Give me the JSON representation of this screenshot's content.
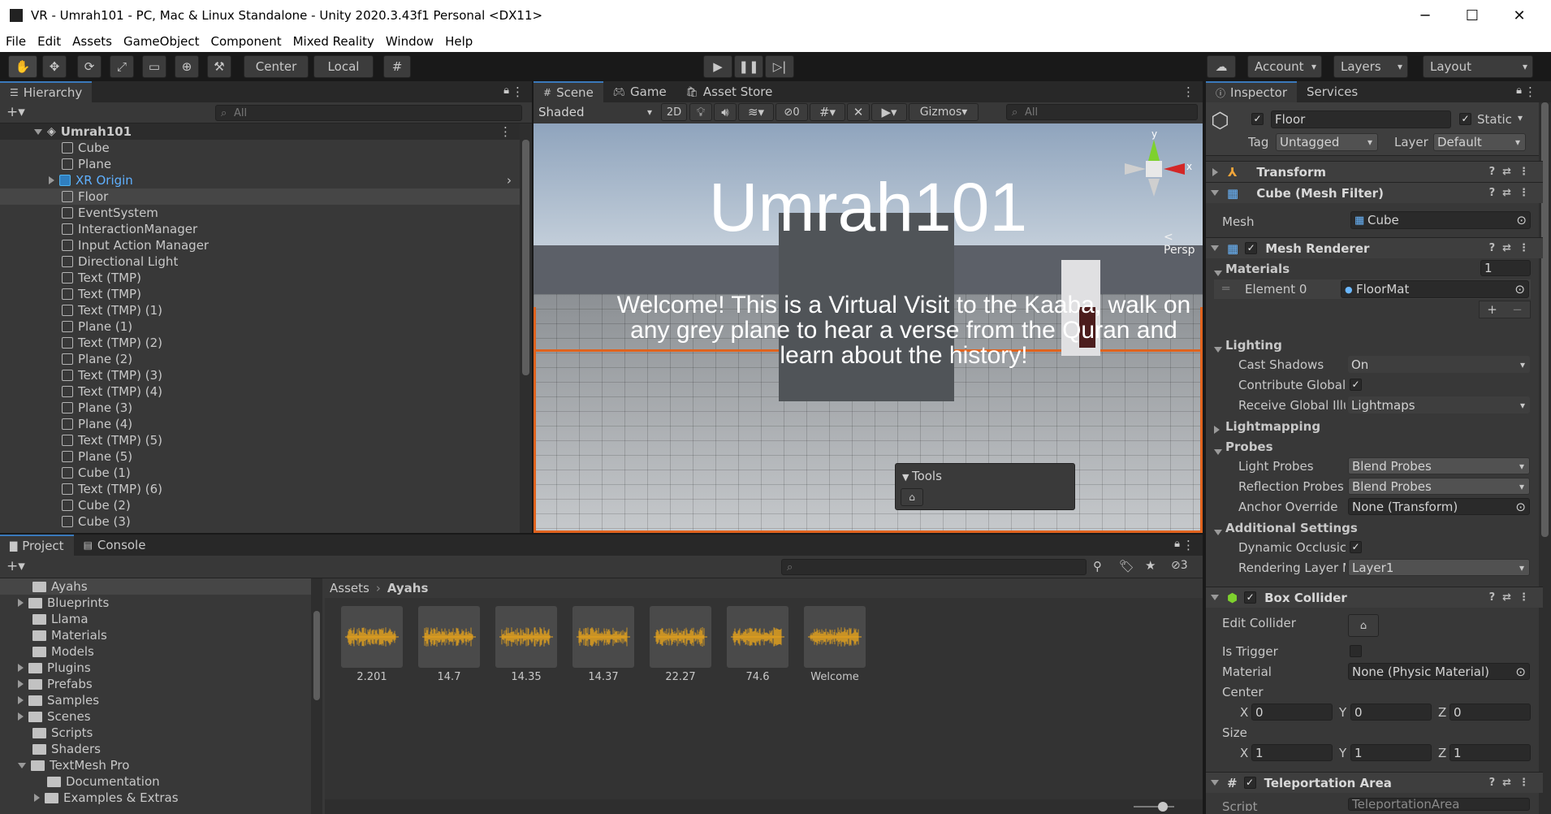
{
  "window": {
    "title": "VR - Umrah101 - PC, Mac & Linux Standalone - Unity 2020.3.43f1 Personal <DX11>"
  },
  "menu": [
    "File",
    "Edit",
    "Assets",
    "GameObject",
    "Component",
    "Mixed Reality",
    "Window",
    "Help"
  ],
  "toolbar": {
    "center": "Center",
    "local": "Local",
    "account": "Account",
    "layers": "Layers",
    "layout": "Layout"
  },
  "hierarchy": {
    "tab": "Hierarchy",
    "search_placeholder": "All",
    "scene": "Umrah101",
    "items": [
      "Cube",
      "Plane",
      "XR Origin",
      "Floor",
      "EventSystem",
      "InteractionManager",
      "Input Action Manager",
      "Directional Light",
      "Text (TMP)",
      "Text (TMP)",
      "Text (TMP) (1)",
      "Plane (1)",
      "Text (TMP) (2)",
      "Plane (2)",
      "Text (TMP) (3)",
      "Text (TMP) (4)",
      "Plane (3)",
      "Plane (4)",
      "Text (TMP) (5)",
      "Plane (5)",
      "Cube (1)",
      "Text (TMP) (6)",
      "Cube (2)",
      "Cube (3)"
    ]
  },
  "scene_view": {
    "tabs": [
      "Scene",
      "Game",
      "Asset Store"
    ],
    "shading": "Shaded",
    "mode_2d": "2D",
    "hidden_count": "0",
    "gizmos": "Gizmos",
    "search_placeholder": "All",
    "persp": "< Persp",
    "axis_x": "x",
    "axis_y": "y",
    "world_title": "Umrah101",
    "world_text": "Welcome! This is a Virtual Visit to the Kaaba, walk on any grey plane to hear a verse from the Quran and learn about the history!",
    "tools_label": "Tools"
  },
  "project": {
    "tabs": [
      "Project",
      "Console"
    ],
    "folders": [
      "Ayahs",
      "Blueprints",
      "Llama",
      "Materials",
      "Models",
      "Plugins",
      "Prefabs",
      "Samples",
      "Scenes",
      "Scripts",
      "Shaders",
      "TextMesh Pro",
      "Documentation",
      "Examples & Extras"
    ],
    "breadcrumb": [
      "Assets",
      "Ayahs"
    ],
    "assets": [
      "2.201",
      "14.7",
      "14.35",
      "14.37",
      "22.27",
      "74.6",
      "Welcome"
    ],
    "hidden_count": "3"
  },
  "inspector": {
    "tabs": [
      "Inspector",
      "Services"
    ],
    "object_name": "Floor",
    "static_label": "Static",
    "tag_label": "Tag",
    "tag_value": "Untagged",
    "layer_label": "Layer",
    "layer_value": "Default",
    "transform": "Transform",
    "mesh_filter": "Cube (Mesh Filter)",
    "mesh_label": "Mesh",
    "mesh_value": "Cube",
    "mesh_renderer": "Mesh Renderer",
    "materials_label": "Materials",
    "materials_count": "1",
    "element0_label": "Element 0",
    "element0_value": "FloorMat",
    "lighting": "Lighting",
    "cast_shadows_label": "Cast Shadows",
    "cast_shadows_value": "On",
    "contribute_gi_label": "Contribute Global",
    "receive_gi_label": "Receive Global Illu",
    "receive_gi_value": "Lightmaps",
    "lightmapping": "Lightmapping",
    "probes": "Probes",
    "light_probes_label": "Light Probes",
    "light_probes_value": "Blend Probes",
    "reflection_probes_label": "Reflection Probes",
    "reflection_probes_value": "Blend Probes",
    "anchor_override_label": "Anchor Override",
    "anchor_override_value": "None (Transform)",
    "additional_settings": "Additional Settings",
    "dynamic_occlusion_label": "Dynamic Occlusic",
    "rendering_layer_label": "Rendering Layer M",
    "rendering_layer_value": "Layer1",
    "box_collider": "Box Collider",
    "edit_collider_label": "Edit Collider",
    "is_trigger_label": "Is Trigger",
    "material_label": "Material",
    "material_value": "None (Physic Material)",
    "center_label": "Center",
    "center": {
      "x": "0",
      "y": "0",
      "z": "0"
    },
    "size_label": "Size",
    "size": {
      "x": "1",
      "y": "1",
      "z": "1"
    },
    "teleportation_area": "Teleportation Area",
    "script_label": "Script",
    "script_value": "TeleportationArea"
  },
  "colors": {
    "accent": "#3a79bb",
    "selection_outline": "#e0631e",
    "audio_wave": "#e8a41c"
  }
}
